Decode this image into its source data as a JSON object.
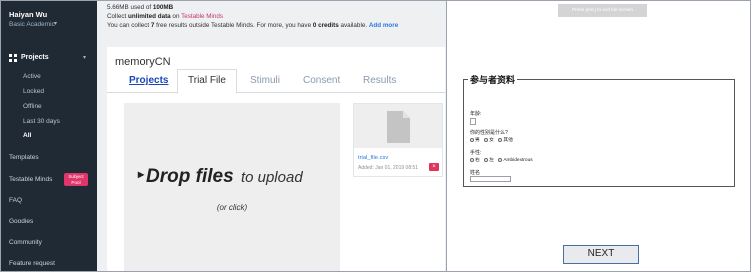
{
  "sidebar": {
    "user_name": "Haiyan Wu",
    "user_role": "Basic Academic",
    "projects_label": "Projects",
    "project_filters": [
      "Active",
      "Locked",
      "Offline",
      "Last 30 days",
      "All"
    ],
    "active_filter": "All",
    "nav": [
      {
        "label": "Templates"
      },
      {
        "label": "Testable Minds",
        "badge": "Subject Pool"
      },
      {
        "label": "FAQ"
      },
      {
        "label": "Goodies"
      },
      {
        "label": "Community"
      },
      {
        "label": "Feature request"
      }
    ]
  },
  "usage": {
    "used": "5.66MB",
    "used_mid": " used of ",
    "quota": "100MB",
    "line2_pre": "Collect ",
    "line2_bold": "unlimited data",
    "line2_mid": " on ",
    "line2_link": "Testable Minds",
    "line3_pre": "You can collect ",
    "line3_count": "7",
    "line3_mid": " free results outside Testable Minds. For more, you have ",
    "line3_credits": "0 credits",
    "line3_post": " available.",
    "add_more": "Add more"
  },
  "project": {
    "title": "memoryCN",
    "tabs": [
      "Projects",
      "Trial File",
      "Stimuli",
      "Consent",
      "Results"
    ],
    "active_tab": "Trial File"
  },
  "dropzone": {
    "main": "Drop files",
    "suffix": "to upload",
    "sub": "(or click)"
  },
  "file": {
    "name": "trial_file.csv",
    "added": "Added: Jan 01, 2019 08:51",
    "delete": "×"
  },
  "participant_form": {
    "toast": "Press [esc] to exit full screen",
    "legend": "参与者资料",
    "age_label": "年龄:",
    "gender_label": "你的性别是什么?",
    "gender_options": [
      "男",
      "女",
      "其他"
    ],
    "hand_label": "手性:",
    "hand_options": [
      "右",
      "左",
      "Ambidextrous"
    ],
    "name_label": "姓名",
    "next_label": "NEXT"
  },
  "colors": {
    "sidebar_bg": "#1f2a35",
    "accent_pink": "#e0356a",
    "link_blue": "#2a7ae2",
    "tab_link": "#1a47b8"
  }
}
